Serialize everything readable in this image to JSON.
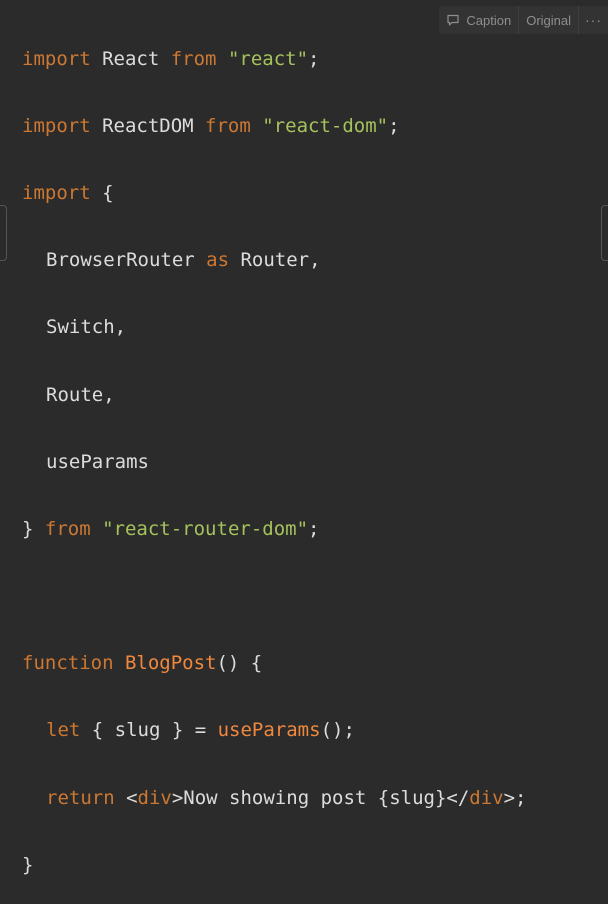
{
  "toolbar": {
    "caption_label": "Caption",
    "original_label": "Original",
    "more_label": "···"
  },
  "code": {
    "l1": {
      "kw1": "import",
      "t1": " React ",
      "kw2": "from",
      "t2": " ",
      "s1": "\"react\"",
      "t3": ";"
    },
    "l2": {
      "kw1": "import",
      "t1": " ReactDOM ",
      "kw2": "from",
      "t2": " ",
      "s1": "\"react-dom\"",
      "t3": ";"
    },
    "l3": {
      "kw1": "import",
      "t1": " {"
    },
    "l4": {
      "t1": "BrowserRouter ",
      "kw1": "as",
      "t2": " Router,"
    },
    "l5": {
      "t1": "Switch,"
    },
    "l6": {
      "t1": "Route,"
    },
    "l7": {
      "t1": "useParams"
    },
    "l8": {
      "t1": "} ",
      "kw1": "from",
      "t2": " ",
      "s1": "\"react-router-dom\"",
      "t3": ";"
    },
    "l10": {
      "kw1": "function",
      "t1": " ",
      "fn1": "BlogPost",
      "t2": "() {"
    },
    "l11": {
      "kw1": "let",
      "t1": " { slug } = ",
      "fn1": "useParams",
      "t2": "();"
    },
    "l12": {
      "kw1": "return",
      "t1": " <",
      "tag1": "div",
      "t2": ">Now showing post {slug}</",
      "tag2": "div",
      "t3": ">;"
    },
    "l13": {
      "t1": "}"
    }
  }
}
